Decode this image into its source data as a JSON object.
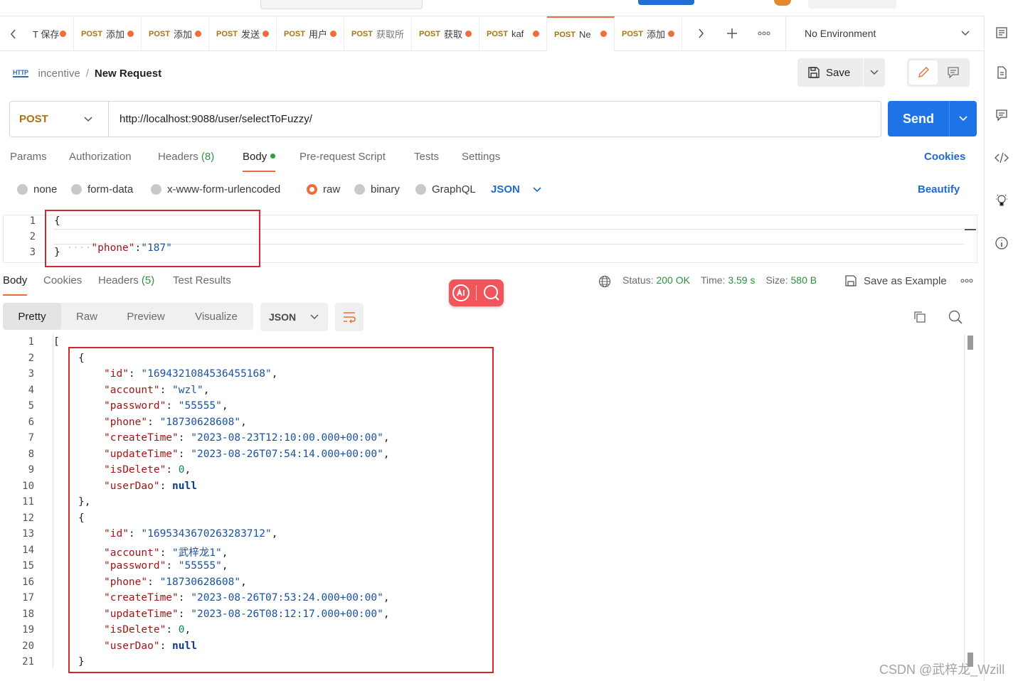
{
  "tabs": [
    {
      "method": "",
      "name": "T 保存",
      "dot": true
    },
    {
      "method": "POST",
      "name": "添加",
      "dot": true
    },
    {
      "method": "POST",
      "name": "添加",
      "dot": true
    },
    {
      "method": "POST",
      "name": "发送",
      "dot": true
    },
    {
      "method": "POST",
      "name": "用户",
      "dot": true
    },
    {
      "method": "POST",
      "name": "获取所",
      "dot": false
    },
    {
      "method": "POST",
      "name": "获取",
      "dot": true
    },
    {
      "method": "POST",
      "name": "kaf",
      "dot": true
    },
    {
      "method": "POST",
      "name": "Ne",
      "dot": true
    },
    {
      "method": "POST",
      "name": "添加",
      "dot": true
    }
  ],
  "environment": {
    "label": "No Environment"
  },
  "breadcrumb": {
    "workspace": "incentive",
    "separator": "/",
    "request": "New Request",
    "http_label": "HTTP"
  },
  "toolbar": {
    "save_label": "Save"
  },
  "request": {
    "method": "POST",
    "url": "http://localhost:9088/user/selectToFuzzy/",
    "send_label": "Send"
  },
  "request_tabs": {
    "params": "Params",
    "authorization": "Authorization",
    "headers": "Headers",
    "headers_count": "(8)",
    "body": "Body",
    "prescript": "Pre-request Script",
    "tests": "Tests",
    "settings": "Settings",
    "cookies": "Cookies"
  },
  "body_types": {
    "none": "none",
    "form_data": "form-data",
    "urlencoded": "x-www-form-urlencoded",
    "raw": "raw",
    "binary": "binary",
    "graphql": "GraphQL",
    "format": "JSON",
    "beautify": "Beautify",
    "selected": "raw"
  },
  "request_body": {
    "lines": [
      "1",
      "2",
      "3"
    ],
    "open": "{",
    "key": "\"phone\"",
    "colon": ":",
    "value": "\"187\"",
    "close": "}"
  },
  "response_tabs": {
    "body": "Body",
    "cookies": "Cookies",
    "headers": "Headers",
    "headers_count": "(5)",
    "test_results": "Test Results"
  },
  "response_status": {
    "status_label": "Status:",
    "status_value": "200 OK",
    "time_label": "Time:",
    "time_value": "3.59 s",
    "size_label": "Size:",
    "size_value": "580 B",
    "save_example": "Save as Example"
  },
  "view_modes": {
    "pretty": "Pretty",
    "raw": "Raw",
    "preview": "Preview",
    "visualize": "Visualize",
    "format": "JSON"
  },
  "response_body": {
    "line_numbers": [
      "1",
      "2",
      "3",
      "4",
      "5",
      "6",
      "7",
      "8",
      "9",
      "10",
      "11",
      "12",
      "13",
      "14",
      "15",
      "16",
      "17",
      "18",
      "19",
      "20",
      "21"
    ],
    "records": [
      {
        "id": "\"1694321084536455168\"",
        "account": "\"wzl\"",
        "password": "\"55555\"",
        "phone": "\"18730628608\"",
        "createTime": "\"2023-08-23T12:10:00.000+00:00\"",
        "updateTime": "\"2023-08-26T07:54:14.000+00:00\"",
        "isDelete": "0",
        "userDao": "null"
      },
      {
        "id": "\"1695343670263283712\"",
        "account": "\"武梓龙1\"",
        "password": "\"55555\"",
        "phone": "\"18730628608\"",
        "createTime": "\"2023-08-26T07:53:24.000+00:00\"",
        "updateTime": "\"2023-08-26T08:12:17.000+00:00\"",
        "isDelete": "0",
        "userDao": "null"
      }
    ],
    "keys": {
      "id": "\"id\"",
      "account": "\"account\"",
      "password": "\"password\"",
      "phone": "\"phone\"",
      "createTime": "\"createTime\"",
      "updateTime": "\"updateTime\"",
      "isDelete": "\"isDelete\"",
      "userDao": "\"userDao\""
    }
  },
  "watermark": "CSDN @武梓龙_Wzill",
  "colors": {
    "accent": "#f26b3a",
    "primary": "#1e73e6",
    "success": "#2f8f3f",
    "annotation": "#d6262c"
  }
}
